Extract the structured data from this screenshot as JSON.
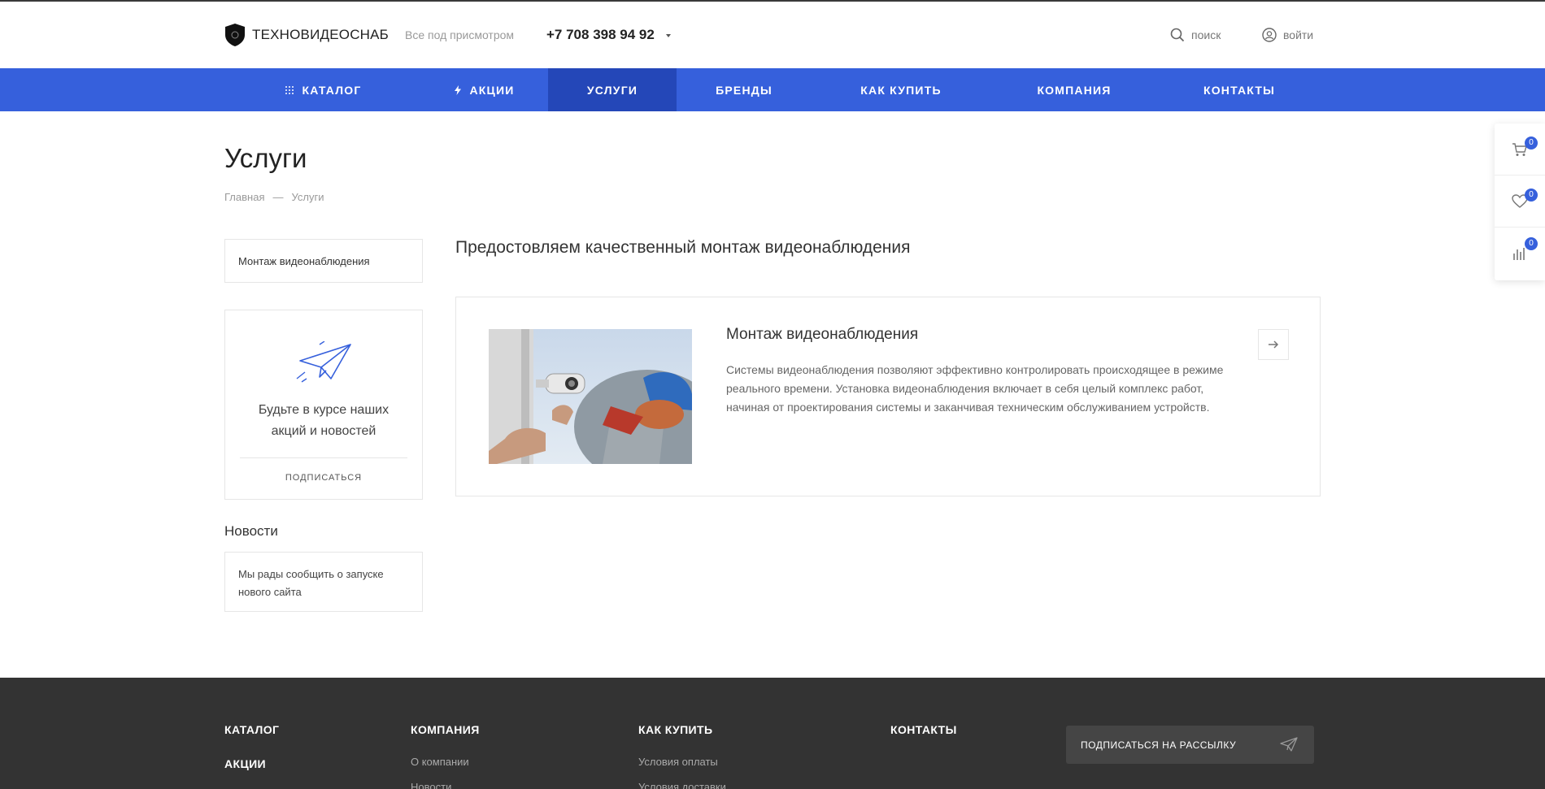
{
  "header": {
    "logo_text": "ТЕХНОВИДЕОСНАБ",
    "slogan": "Все под присмотром",
    "phone": "+7 708 398 94 92",
    "search_label": "поиск",
    "login_label": "войти"
  },
  "nav": {
    "items": [
      {
        "label": "КАТАЛОГ",
        "icon": "grid-icon"
      },
      {
        "label": "АКЦИИ",
        "icon": "lightning-icon"
      },
      {
        "label": "УСЛУГИ",
        "active": true
      },
      {
        "label": "БРЕНДЫ"
      },
      {
        "label": "КАК КУПИТЬ"
      },
      {
        "label": "КОМПАНИЯ"
      },
      {
        "label": "КОНТАКТЫ"
      }
    ],
    "color": "#3660dc",
    "active_color": "#2447b8"
  },
  "page": {
    "title": "Услуги",
    "breadcrumb": {
      "home": "Главная",
      "separator": "—",
      "current": "Услуги"
    }
  },
  "sidebar": {
    "menu_item": "Монтаж видеонаблюдения",
    "subscribe": {
      "text": "Будьте в курсе наших акций и новостей",
      "button": "ПОДПИСАТЬСЯ"
    },
    "news": {
      "title": "Новости",
      "item": "Мы рады сообщить о запуске нового сайта"
    }
  },
  "main": {
    "heading": "Предостовляем качественный монтаж видеонаблюдения",
    "service": {
      "title": "Монтаж видеонаблюдения",
      "description": "Системы видеонаблюдения позволяют эффективно контролировать происходящее в режиме реального времени. Установка видеонаблюдения включает в себя целый комплекс работ, начиная от проектирования системы и заканчивая техническим обслуживанием устройств."
    }
  },
  "widget": {
    "cart_count": "0",
    "favorites_count": "0",
    "compare_count": "0"
  },
  "footer": {
    "catalog": "КАТАЛОГ",
    "sales": "АКЦИИ",
    "company": {
      "title": "КОМПАНИЯ",
      "links": [
        "О компании",
        "Новости"
      ]
    },
    "how_to_buy": {
      "title": "КАК КУПИТЬ",
      "links": [
        "Условия оплаты",
        "Условия доставки"
      ]
    },
    "contacts": "КОНТАКТЫ",
    "subscribe_button": "ПОДПИСАТЬСЯ НА РАССЫЛКУ"
  }
}
